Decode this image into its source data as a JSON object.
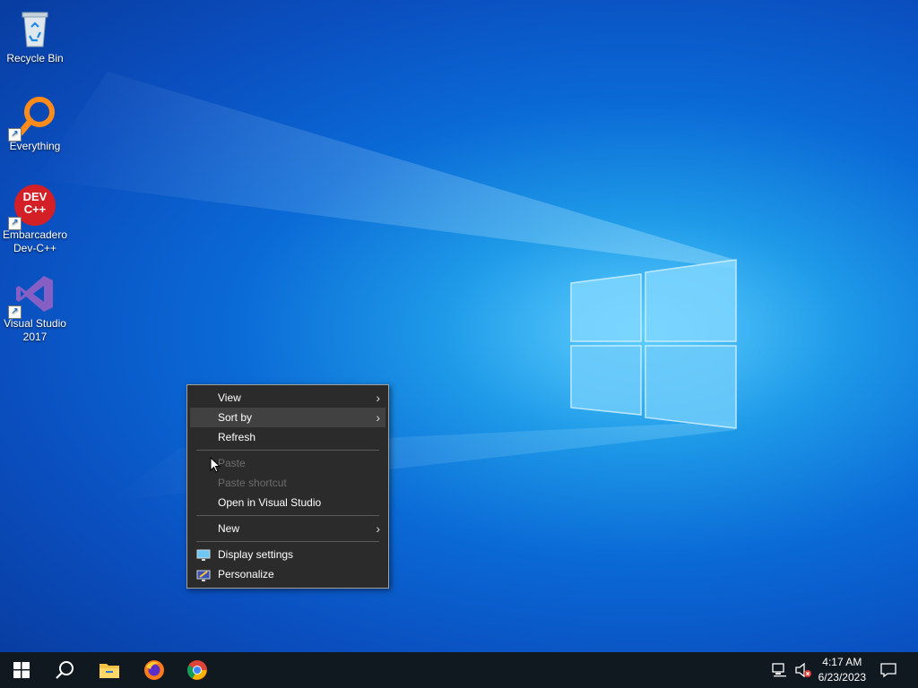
{
  "desktop": {
    "icons": [
      {
        "label": "Recycle Bin",
        "icon": "recycle-bin-icon"
      },
      {
        "label": "Everything",
        "icon": "everything-search-icon"
      },
      {
        "label": "Embarcadero Dev-C++",
        "icon": "devcpp-icon",
        "icon_text": "DEV C++"
      },
      {
        "label": "Visual Studio 2017",
        "icon": "visual-studio-icon"
      }
    ]
  },
  "context_menu": {
    "items": [
      {
        "label": "View",
        "submenu": true
      },
      {
        "label": "Sort by",
        "submenu": true,
        "highlighted": true
      },
      {
        "label": "Refresh"
      },
      {
        "label": "Paste",
        "disabled": true
      },
      {
        "label": "Paste shortcut",
        "disabled": true
      },
      {
        "label": "Open in Visual Studio"
      },
      {
        "label": "New",
        "submenu": true
      },
      {
        "label": "Display settings",
        "icon": "display-settings-icon"
      },
      {
        "label": "Personalize",
        "icon": "personalize-icon"
      }
    ],
    "submenu_arrow": "›"
  },
  "taskbar": {
    "apps": [
      "start-icon",
      "search-icon",
      "file-explorer-icon",
      "firefox-icon",
      "chrome-icon"
    ],
    "tray": {
      "time": "4:17 AM",
      "date": "6/23/2023",
      "icons": [
        "network-icon",
        "volume-muted-icon",
        "notifications-icon"
      ]
    }
  },
  "colors": {
    "menu_bg": "#2b2b2b",
    "menu_highlight": "#414141",
    "taskbar_bg": "#101820",
    "disabled_text": "#6d6d6d"
  }
}
